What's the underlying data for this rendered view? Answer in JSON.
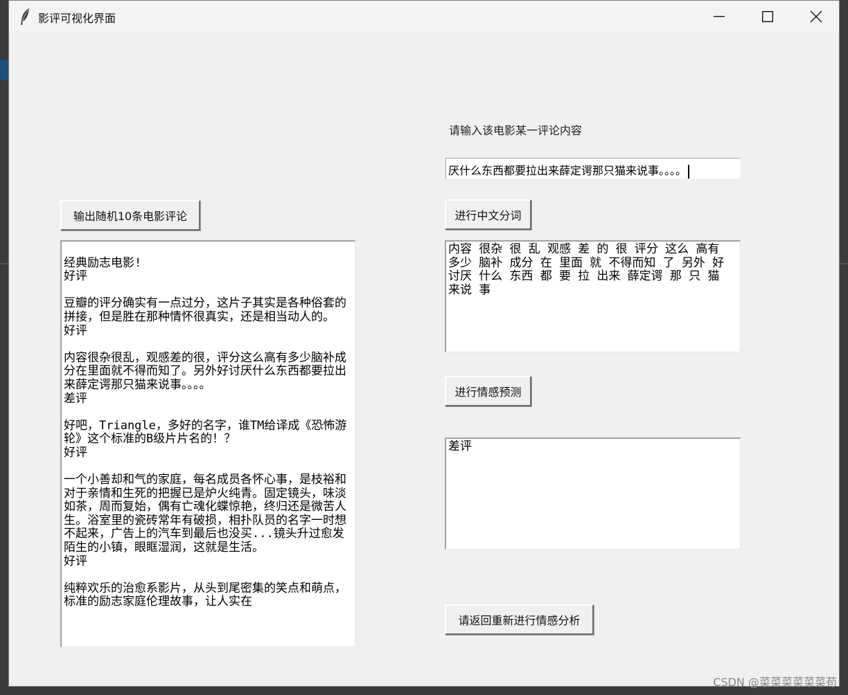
{
  "window": {
    "title": "影评可视化界面"
  },
  "left": {
    "random_button_label": "输出随机10条电影评论",
    "reviews_text": "\n经典励志电影!\n好评\n\n豆瓣的评分确实有一点过分，这片子其实是各种俗套的拼接，但是胜在那种情怀很真实，还是相当动人的。\n好评\n\n内容很杂很乱，观感差的很，评分这么高有多少脑补成分在里面就不得而知了。另外好讨厌什么东西都要拉出来薛定谔那只猫来说事。。。。\n差评\n\n好吧，Triangle，多好的名字，谁TM给译成《恐怖游轮》这个标准的B级片片名的！？\n好评\n\n一个小善却和气的家庭，每名成员各怀心事，是枝裕和对于亲情和生死的把握已是炉火纯青。固定镜头，味淡如茶，周而复始，偶有亡魂化蝶惊艳，终归还是微苦人生。浴室里的瓷砖常年有破损，相扑队员的名字一时想不起来，广告上的汽车到最后也没买...镜头升过愈发陌生的小镇，眼眶湿润，这就是生活。\n好评\n\n纯粹欢乐的治愈系影片，从头到尾密集的笑点和萌点，标准的励志家庭伦理故事，让人实在"
  },
  "right": {
    "prompt_label": "请输入该电影某一评论内容",
    "entry_value": "厌什么东西都要拉出来薛定谔那只猫来说事。。。。",
    "segment_button_label": "进行中文分词",
    "segment_output": "内容 很杂 很 乱 观感 差 的 很 评分 这么 高有 多少 脑补 成分 在 里面 就 不得而知 了 另外 好 讨厌 什么 东西 都 要 拉 出来 薛定谔 那 只 猫 来说 事",
    "sentiment_button_label": "进行情感预测",
    "sentiment_output": "差评",
    "reset_button_label": "请返回重新进行情感分析"
  },
  "watermark": "CSDN @菜菜菜菜菜菜苟",
  "colors": {
    "window_bg": "#f0f0f0",
    "text_bg": "#ffffff"
  },
  "icons": [
    "feather-icon",
    "minimize-icon",
    "maximize-icon",
    "close-icon"
  ]
}
